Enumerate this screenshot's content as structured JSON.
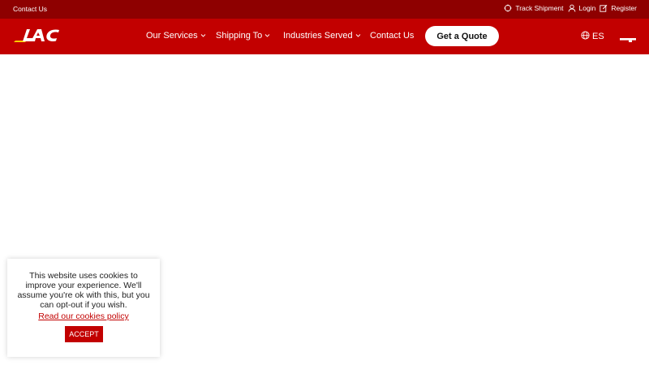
{
  "topbar": {
    "contact_label": "Contact Us",
    "track_label": "Track Shipment",
    "login_label": "Login",
    "register_label": "Register"
  },
  "header": {
    "logo_text": "LAC",
    "nav": [
      {
        "label": "Our Services",
        "has_dropdown": true
      },
      {
        "label": "Shipping To",
        "has_dropdown": true
      },
      {
        "label": "Industries Served",
        "has_dropdown": true
      },
      {
        "label": "Contact Us",
        "has_dropdown": false
      }
    ],
    "quote_label": "Get a Quote",
    "language_label": "ES"
  },
  "cookie_banner": {
    "message": "This website uses cookies to improve your experience. We'll assume you're ok with this, but you can opt-out if you wish.",
    "policy_link": "Read our cookies policy",
    "accept_label": "ACCEPT"
  },
  "colors": {
    "topbar_bg": "#8e0000",
    "header_bg": "#c20000",
    "accent": "#c20000"
  }
}
